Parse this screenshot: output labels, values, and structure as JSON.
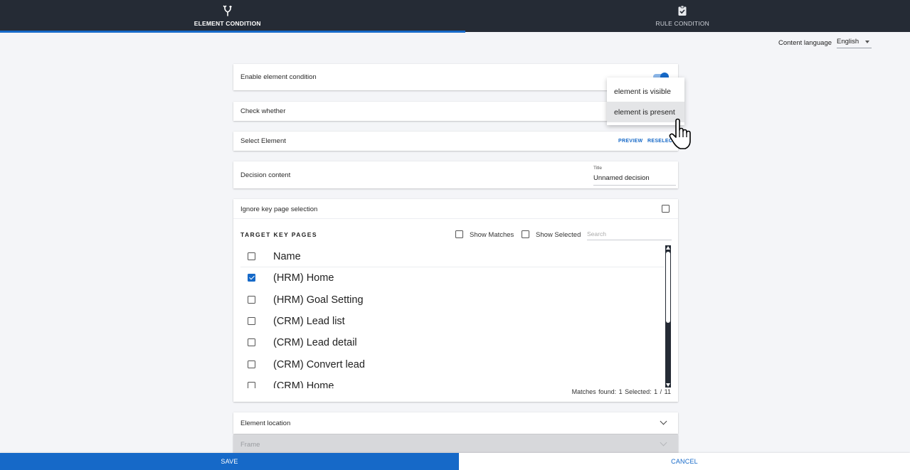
{
  "tabs": [
    {
      "label": "ELEMENT CONDITION",
      "icon": "fork-icon",
      "active": true
    },
    {
      "label": "RULE CONDITION",
      "icon": "clipboard-check-icon",
      "active": false
    }
  ],
  "content_language": {
    "label": "Content language",
    "value": "English"
  },
  "enable_card": {
    "label": "Enable element condition",
    "toggle_on": true
  },
  "check_card": {
    "label": "Check whether"
  },
  "select_card": {
    "label": "Select Element",
    "preview_label": "PREVIEW",
    "reselect_label": "RESELECT"
  },
  "decision_card": {
    "label": "Decision content",
    "title_caption": "Title",
    "title_value": "Unnamed decision"
  },
  "keypages": {
    "ignore_label": "Ignore key page selection",
    "heading": "TARGET KEY PAGES",
    "show_matches_label": "Show Matches",
    "show_selected_label": "Show Selected",
    "search_placeholder": "Search",
    "column_header": "Name",
    "rows": [
      {
        "name": "(HRM) Home",
        "checked": true
      },
      {
        "name": "(HRM) Goal Setting",
        "checked": false
      },
      {
        "name": "(CRM) Lead list",
        "checked": false
      },
      {
        "name": "(CRM) Lead detail",
        "checked": false
      },
      {
        "name": "(CRM) Convert lead",
        "checked": false
      },
      {
        "name": "(CRM) Home",
        "checked": false
      }
    ],
    "footer": "Matches found: 1   Selected: 1 / 11"
  },
  "location_card": {
    "label": "Element location"
  },
  "frame_card": {
    "label": "Frame"
  },
  "dropdown": {
    "options": [
      "element is visible",
      "element is present"
    ],
    "hovered_index": 1
  },
  "actions": {
    "save_label": "SAVE",
    "cancel_label": "CANCEL"
  },
  "colors": {
    "accent": "#1669c8",
    "topbar": "#252b35",
    "background": "#f4f5f8"
  }
}
